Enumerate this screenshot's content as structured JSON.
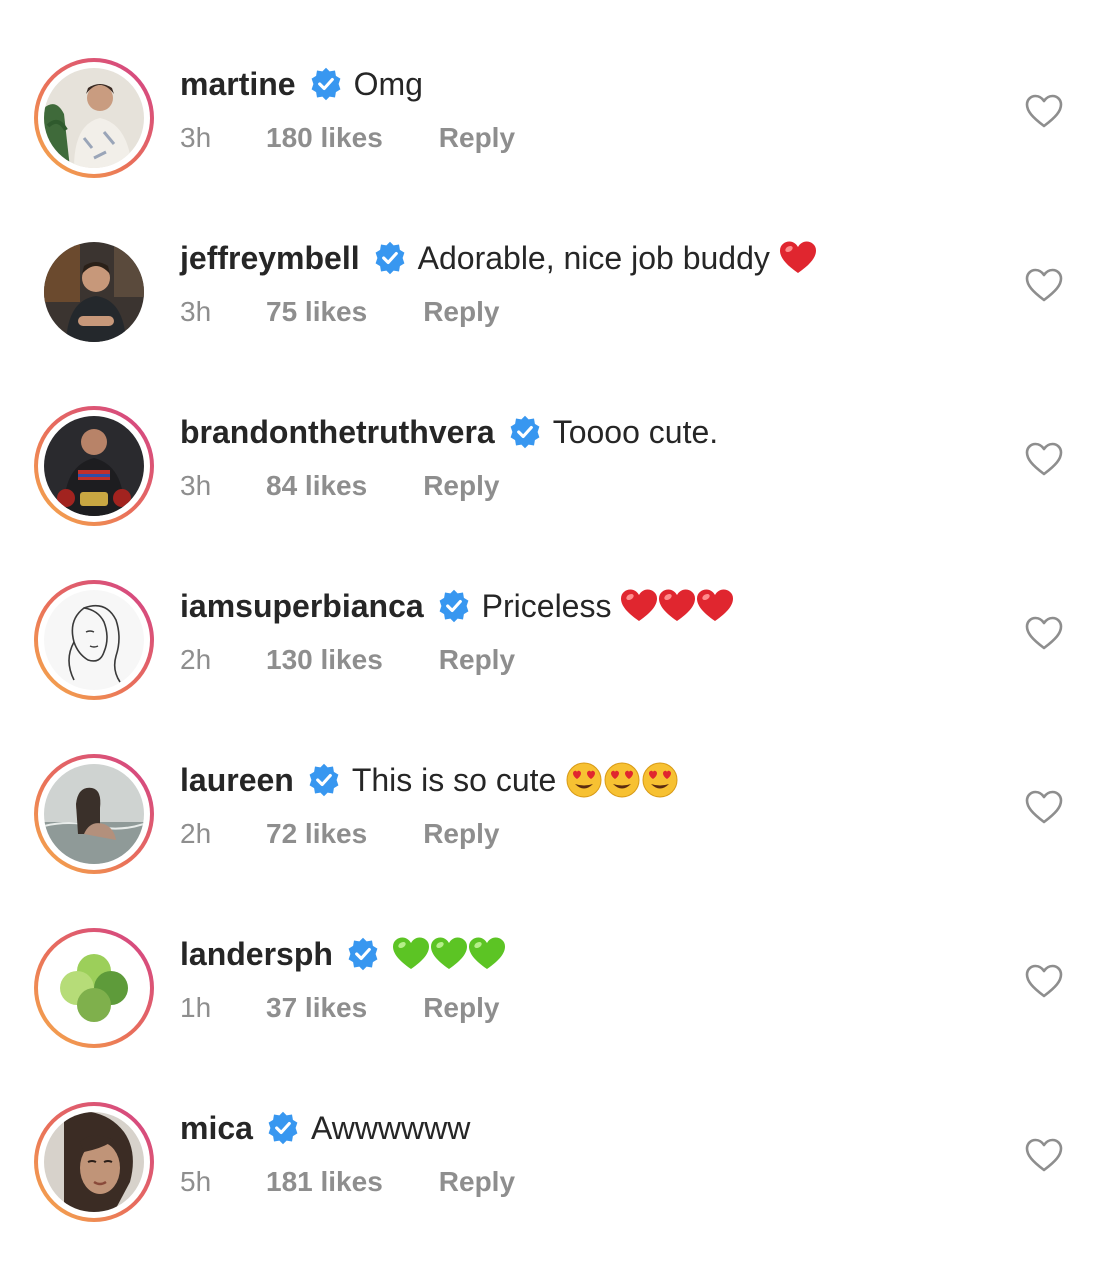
{
  "comments": [
    {
      "username": "martine",
      "text": "Omg",
      "emojis": [],
      "time": "3h",
      "likes": "180 likes",
      "reply": "Reply",
      "has_story_ring": true,
      "avatar_icon": "woman-portrait-avatar"
    },
    {
      "username": "jeffreymbell",
      "text": "Adorable, nice job buddy",
      "emojis": [
        "red-heart"
      ],
      "time": "3h",
      "likes": "75 likes",
      "reply": "Reply",
      "has_story_ring": false,
      "avatar_icon": "man-portrait-avatar"
    },
    {
      "username": "brandonthetruthvera",
      "text": "Toooo cute.",
      "emojis": [],
      "time": "3h",
      "likes": "84 likes",
      "reply": "Reply",
      "has_story_ring": true,
      "avatar_icon": "fighter-portrait-avatar"
    },
    {
      "username": "iamsuperbianca",
      "text": "Priceless",
      "emojis": [
        "red-heart",
        "red-heart",
        "red-heart"
      ],
      "time": "2h",
      "likes": "130 likes",
      "reply": "Reply",
      "has_story_ring": true,
      "avatar_icon": "line-drawing-face-avatar"
    },
    {
      "username": "laureen",
      "text": "This is so cute",
      "emojis": [
        "heart-eyes",
        "heart-eyes",
        "heart-eyes"
      ],
      "time": "2h",
      "likes": "72 likes",
      "reply": "Reply",
      "has_story_ring": true,
      "avatar_icon": "woman-water-avatar"
    },
    {
      "username": "landersph",
      "text": "",
      "emojis": [
        "green-heart",
        "green-heart",
        "green-heart"
      ],
      "time": "1h",
      "likes": "37 likes",
      "reply": "Reply",
      "has_story_ring": true,
      "avatar_icon": "green-circles-logo-avatar"
    },
    {
      "username": "mica",
      "text": "Awwwwww",
      "emojis": [],
      "time": "5h",
      "likes": "181 likes",
      "reply": "Reply",
      "has_story_ring": true,
      "avatar_icon": "woman-closeup-avatar"
    }
  ],
  "icons": {
    "verified_badge": "verified-badge-icon",
    "like": "heart-outline-icon"
  },
  "colors": {
    "verified_blue": "#3897f0",
    "meta_gray": "#8e8e8e",
    "text": "#262626",
    "heart_red": "#e0262f",
    "heart_green": "#5cc424"
  }
}
